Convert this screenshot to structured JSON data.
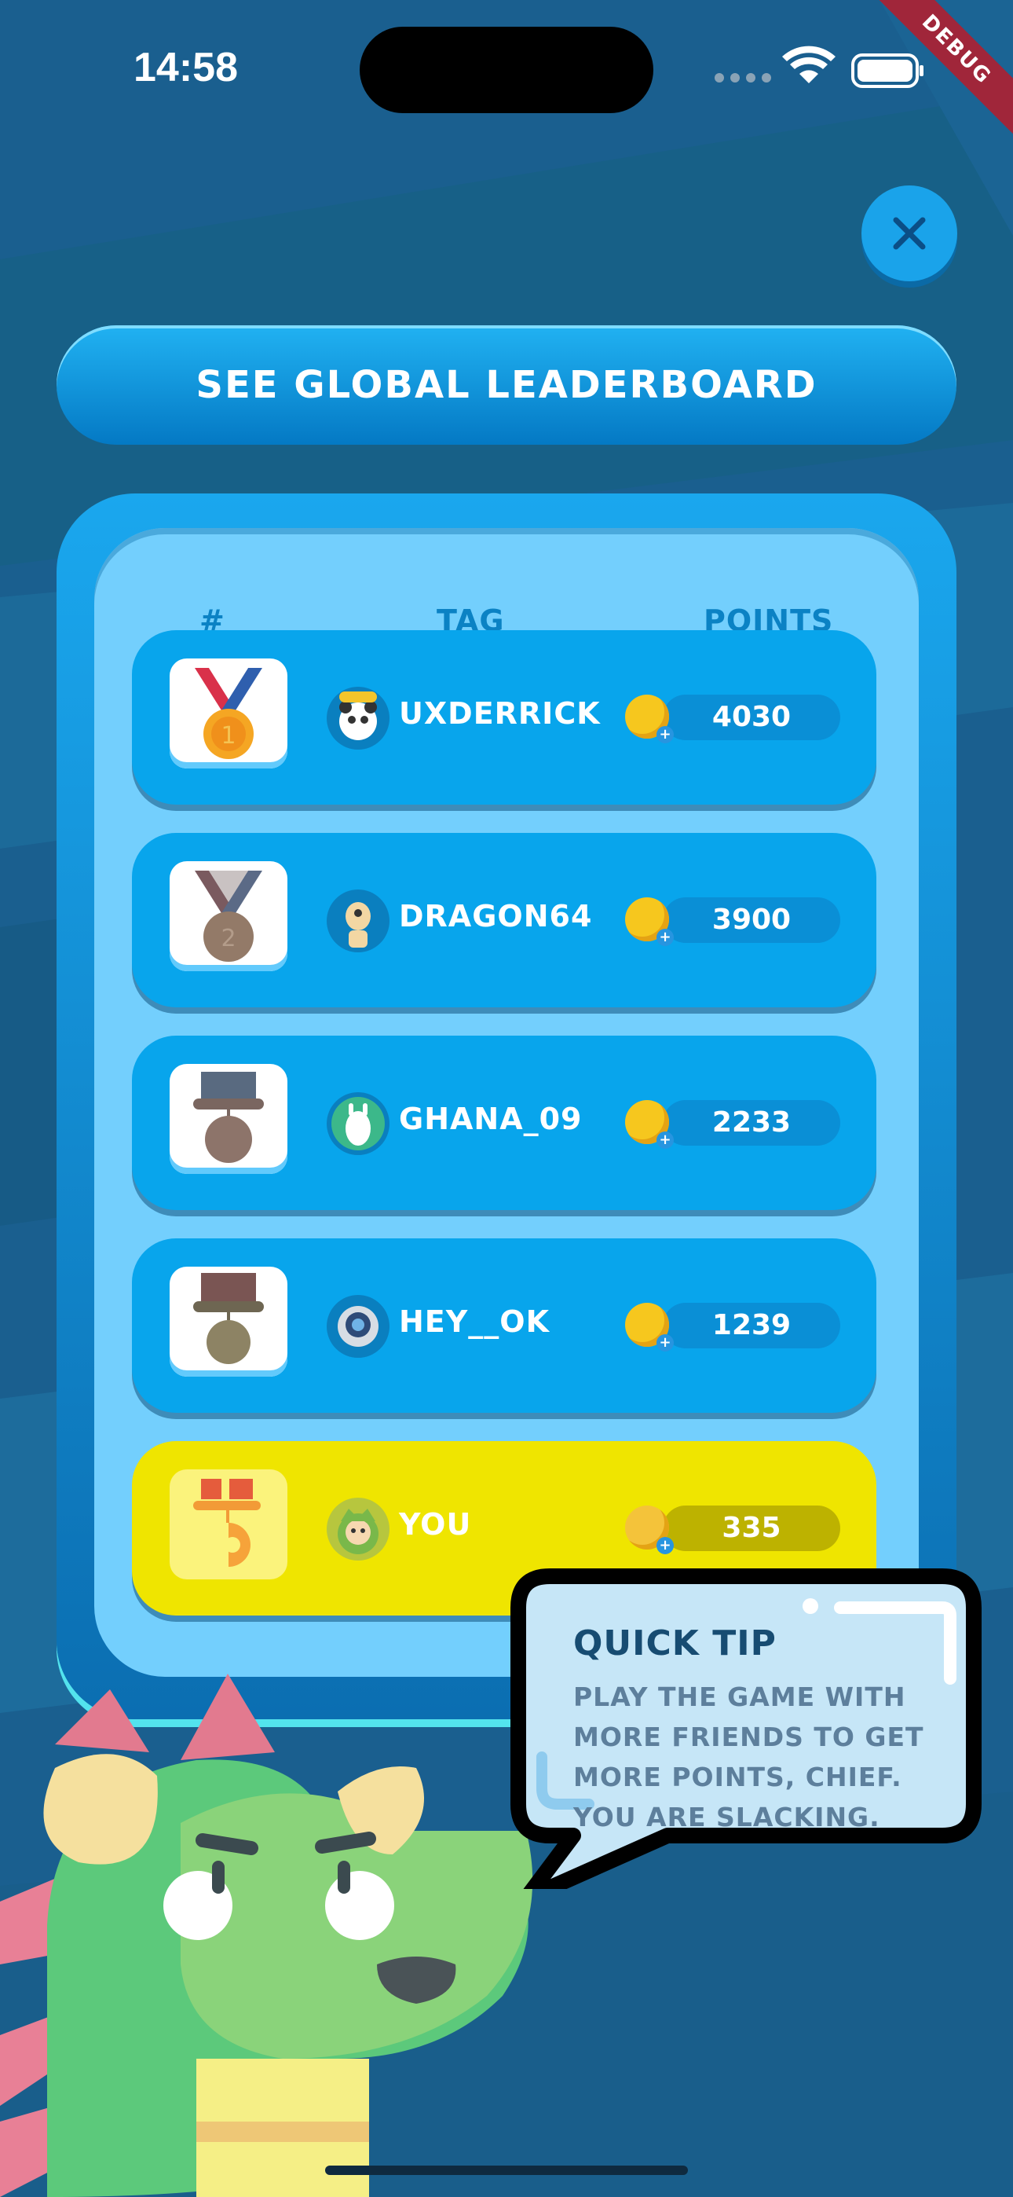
{
  "status_bar": {
    "time": "14:58",
    "debug": "DEBUG"
  },
  "global_button": {
    "label": "SEE GLOBAL LEADERBOARD"
  },
  "table": {
    "headers": [
      "#",
      "TAG",
      "POINTS"
    ],
    "rows": [
      {
        "rank_icon": "gold-medal-icon",
        "avatar": "panda-avatar",
        "tag": "UXDERRICK",
        "points": "4030"
      },
      {
        "rank_icon": "silver-medal-icon",
        "avatar": "alien-avatar",
        "tag": "DRAGON64",
        "points": "3900"
      },
      {
        "rank_icon": "bronze-medal-icon",
        "avatar": "llama-avatar",
        "tag": "GHANA_09",
        "points": "2233"
      },
      {
        "rank_icon": "medal-icon",
        "avatar": "astronaut-avatar",
        "tag": "HEY__OK",
        "points": "1239"
      },
      {
        "rank_icon": "medal-icon",
        "avatar": "kid-avatar",
        "tag": "YOU",
        "points": "335"
      }
    ]
  },
  "tip": {
    "title": "QUICK TIP",
    "text": "PLAY THE GAME WITH MORE FRIENDS TO GET MORE POINTS, CHIEF. YOU ARE SLACKING."
  },
  "colors": {
    "background": "#1a5f8f",
    "row": "#08a5ec",
    "you_row": "#efe500",
    "panel": "#73cffd"
  }
}
